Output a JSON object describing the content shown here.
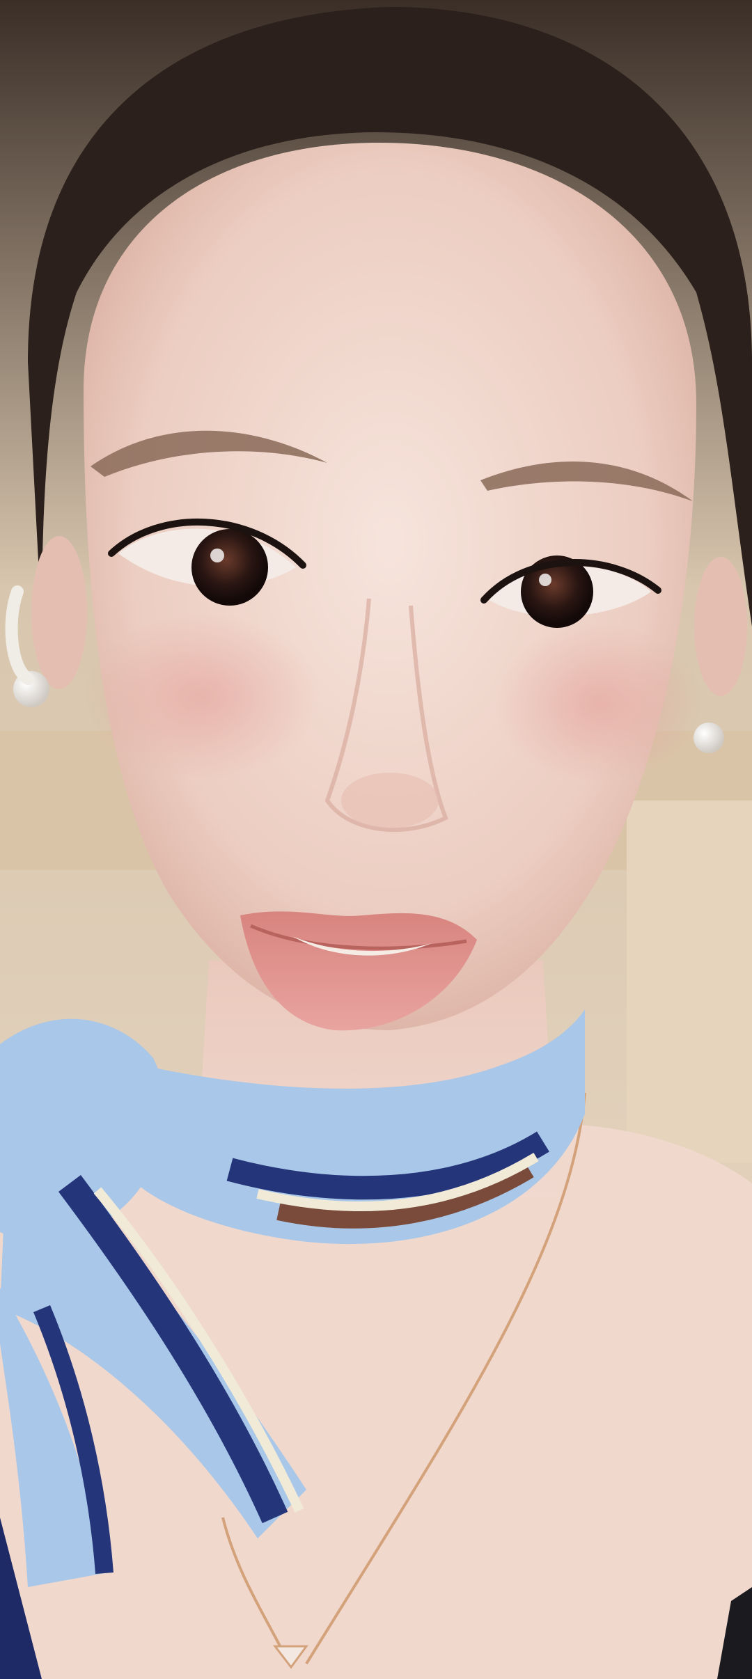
{
  "image": {
    "kind": "photograph",
    "ui_text": []
  },
  "palette": {
    "background_wall": "#e8d6bf",
    "background_panel": "#d9c3a4",
    "hair": "#2a1f1a",
    "skin_light": "#f3ddd4",
    "skin_mid": "#e9c5b7",
    "blush": "#e9a8a1",
    "lips": "#d98b8a",
    "eye_dark": "#1c1210",
    "scarf_light_blue": "#a9c7e8",
    "scarf_navy": "#24357a",
    "scarf_cream": "#f0ead7",
    "scarf_brown": "#7a4a3a",
    "pearl": "#f5f3ef",
    "necklace_gold": "#d4a27a"
  }
}
